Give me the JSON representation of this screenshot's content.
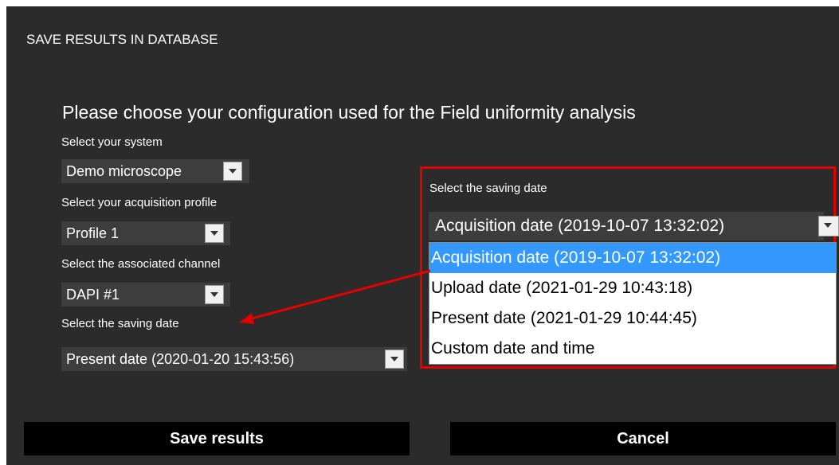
{
  "dialog": {
    "title": "SAVE RESULTS IN DATABASE",
    "heading": "Please choose your configuration used for the Field uniformity analysis"
  },
  "form": {
    "system_label": "Select your system",
    "system_value": "Demo microscope",
    "profile_label": "Select your acquisition profile",
    "profile_value": "Profile 1",
    "channel_label": "Select the associated channel",
    "channel_value": "DAPI #1",
    "date_label": "Select the saving date",
    "date_value": "Present date (2020-01-20 15:43:56)"
  },
  "zoom_callout": {
    "label": "Select the saving date",
    "selected": "Acquisition date (2019-10-07 13:32:02)",
    "options": [
      "Acquisition date (2019-10-07 13:32:02)",
      "Upload date (2021-01-29 10:43:18)",
      "Present date (2021-01-29 10:44:45)",
      "Custom date and time"
    ],
    "highlight_color": "#3399ff",
    "annotation_color": "#e00000"
  },
  "buttons": {
    "save": "Save results",
    "cancel": "Cancel"
  },
  "icons": {
    "dropdown": "chevron-down-icon"
  }
}
